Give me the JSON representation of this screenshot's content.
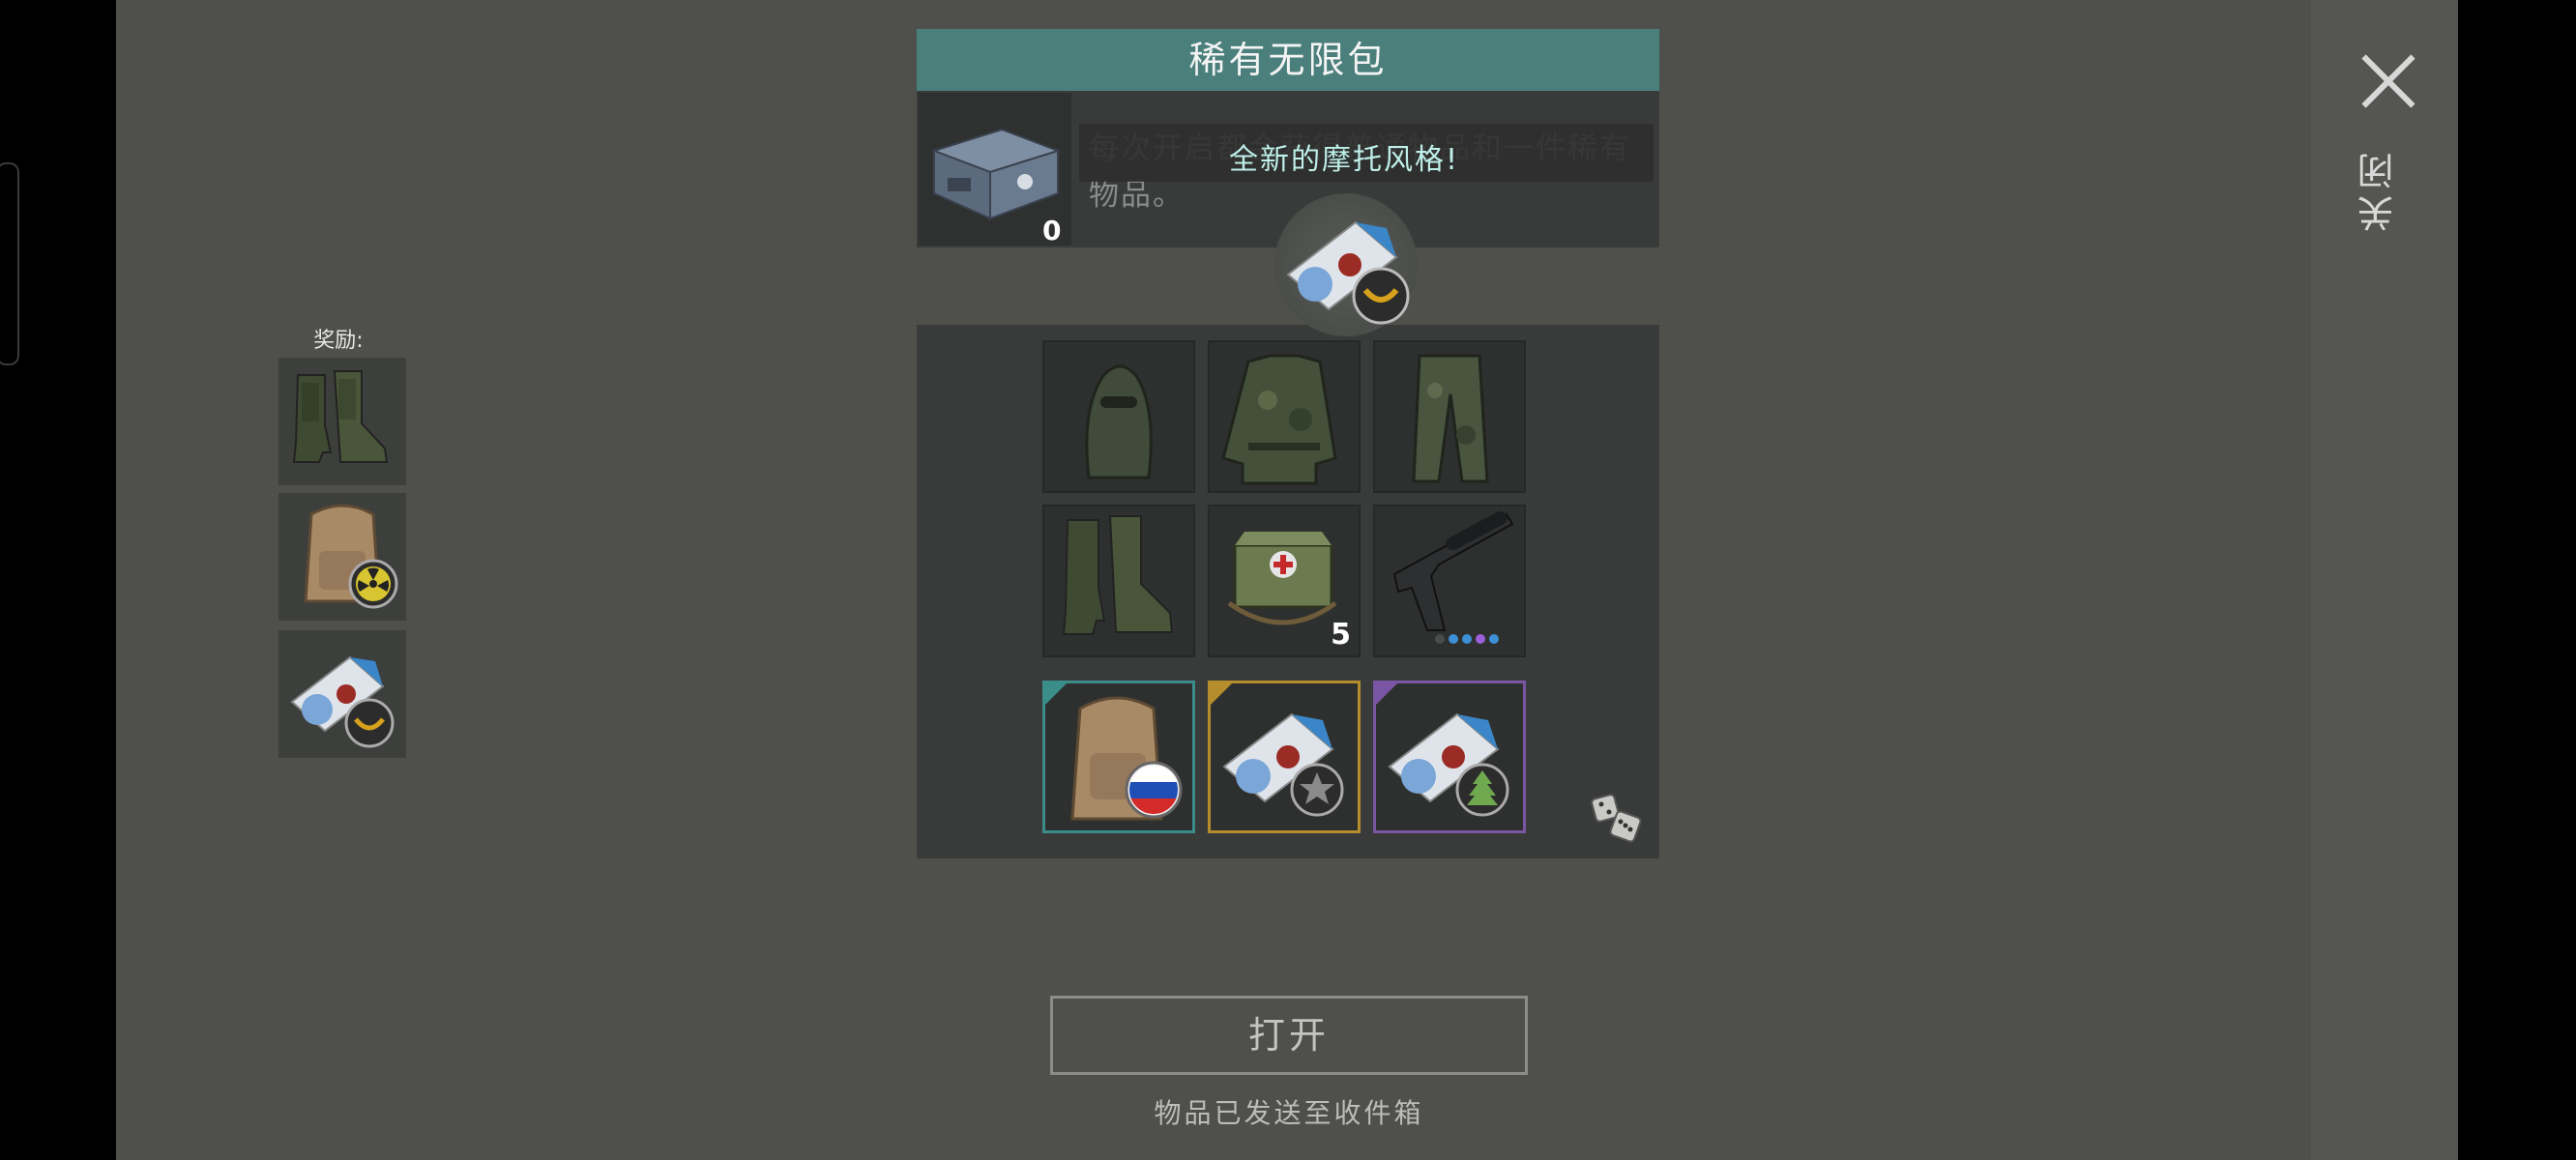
{
  "panel": {
    "title": "稀有无限包",
    "description": "每次开启都会获得普通物品和一件稀有物品。",
    "chest_count": "0"
  },
  "tooltip": {
    "text": "全新的摩托风格!",
    "icon": "motorcycle-style-manual-icon"
  },
  "rewards": {
    "label": "奖励:",
    "items": [
      {
        "icon": "boots-icon"
      },
      {
        "icon": "backpack-radiation-icon"
      },
      {
        "icon": "manual-badge-icon"
      }
    ]
  },
  "grid": {
    "items": [
      {
        "icon": "balaclava-icon",
        "rarity": "none"
      },
      {
        "icon": "camo-jacket-icon",
        "rarity": "none"
      },
      {
        "icon": "camo-pants-icon",
        "rarity": "none"
      },
      {
        "icon": "boots-icon",
        "rarity": "none"
      },
      {
        "icon": "medkit-bag-icon",
        "rarity": "none",
        "count": "5"
      },
      {
        "icon": "silenced-pistol-icon",
        "rarity": "none",
        "mod_dot_colors": [
          "#4a4c49",
          "#3d8fd6",
          "#3d8fd6",
          "#9b5fd8",
          "#3d8fd6"
        ]
      },
      {
        "icon": "backpack-russia-flag-icon",
        "rarity": "teal"
      },
      {
        "icon": "manual-star-badge-icon",
        "rarity": "gold"
      },
      {
        "icon": "manual-tree-badge-icon",
        "rarity": "purple"
      }
    ]
  },
  "dice_icon": "dice-icon",
  "open_button": {
    "label": "打开"
  },
  "status": {
    "text": "物品已发送至收件箱"
  },
  "close": {
    "label": "关闭",
    "icon": "close-icon"
  },
  "colors": {
    "background": "#4f504b",
    "title_bar": "#4a7f7b",
    "rarity_teal": "#3b8d8a",
    "rarity_gold": "#b58d2c",
    "rarity_purple": "#7a55a3",
    "tooltip_text": "#bff0ea"
  }
}
